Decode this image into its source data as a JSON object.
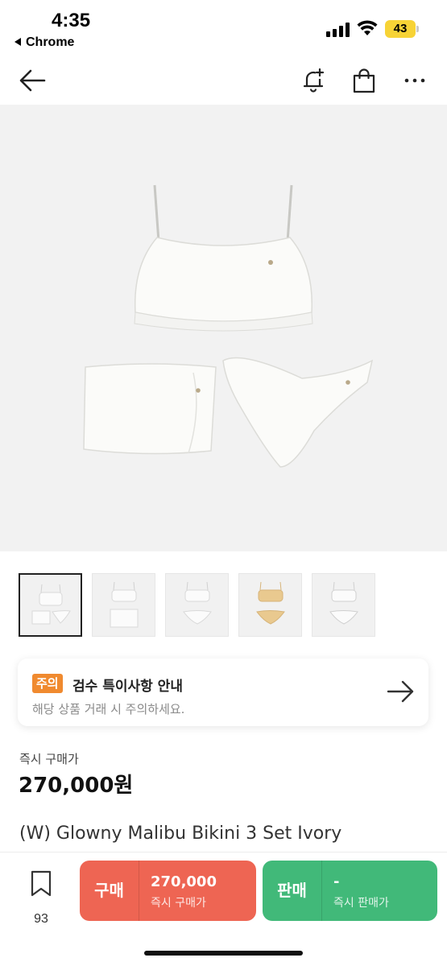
{
  "status_bar": {
    "time": "4:35",
    "back_app": "Chrome",
    "battery": "43",
    "battery_color": "#f7d336"
  },
  "navbar": {
    "icons": [
      "back-arrow-icon",
      "bell-plus-icon",
      "shopping-bag-icon",
      "more-icon"
    ]
  },
  "product": {
    "thumbnails": [
      "thumb-1",
      "thumb-2",
      "thumb-3",
      "thumb-4",
      "thumb-5"
    ],
    "active_thumbnail": 0
  },
  "notice": {
    "badge": "주의",
    "title": "검수 특이사항 안내",
    "subtitle": "해당 상품 거래 시 주의하세요.",
    "badge_color": "#f08a2f"
  },
  "price": {
    "label": "즉시 구매가",
    "value": "270,000원"
  },
  "product_name": "(W) Glowny Malibu Bikini 3 Set Ivory",
  "bottom_bar": {
    "bookmark_count": "93",
    "buy": {
      "label": "구매",
      "price": "270,000",
      "sub": "즉시 구매가",
      "color": "#ee6553"
    },
    "sell": {
      "label": "판매",
      "price": "-",
      "sub": "즉시 판매가",
      "color": "#41b979"
    }
  }
}
